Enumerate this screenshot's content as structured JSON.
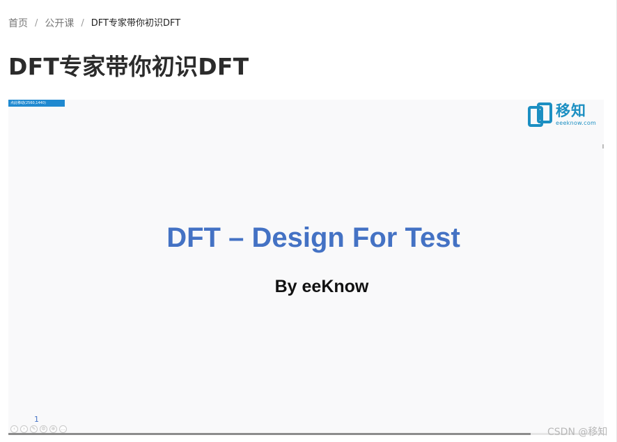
{
  "breadcrumb": {
    "home": "首页",
    "section": "公开课",
    "current": "DFT专家带你初识DFT",
    "separator": "/"
  },
  "page": {
    "title": "DFT专家带你初识DFT"
  },
  "player": {
    "resolution_tag": "点此移动(2560,1440)",
    "logo_name": "移知",
    "logo_url": "eeeknow.com",
    "slide_title": "DFT – Design For Test",
    "slide_subtitle": "By eeKnow",
    "slide_number": "1",
    "progress": 0.877,
    "controls": [
      "prev-icon",
      "next-icon",
      "pen-icon",
      "settings-icon",
      "zoom-icon",
      "more-icon"
    ],
    "colors": {
      "slide_title": "#4472c4",
      "logo": "#1c8fc2",
      "tag": "#1f89d0"
    }
  },
  "watermark": "CSDN @移知"
}
